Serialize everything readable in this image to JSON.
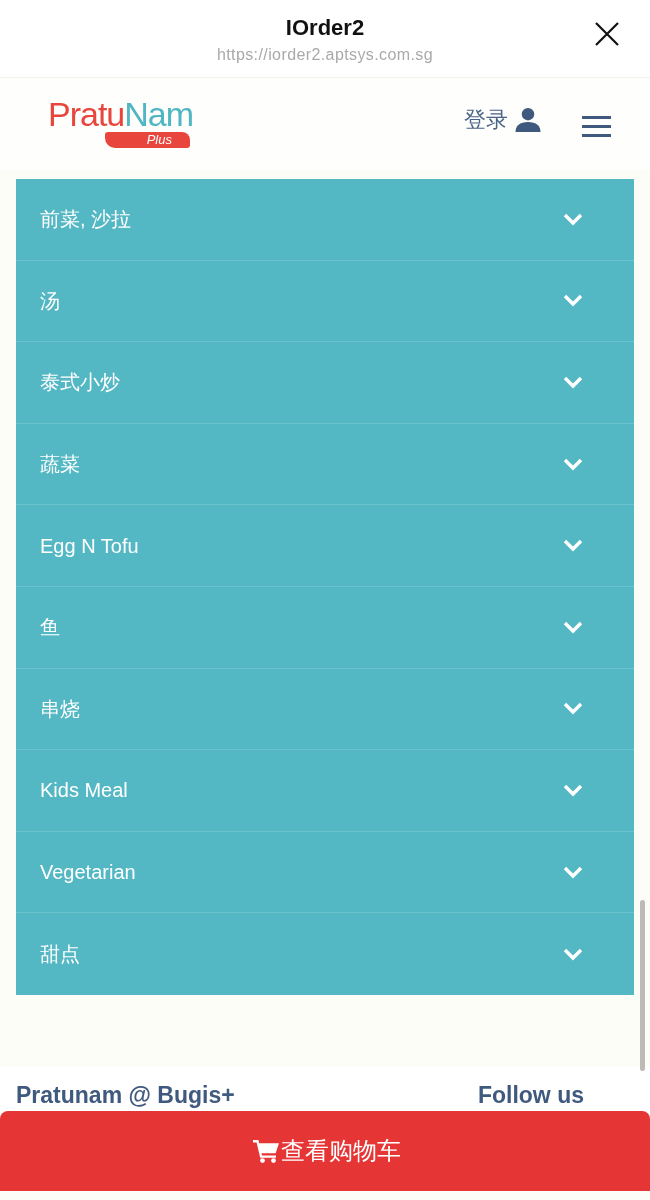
{
  "browser_bar": {
    "title": "IOrder2",
    "url": "https://iorder2.aptsys.com.sg"
  },
  "header": {
    "logo": {
      "word_1": "Pratu",
      "word_2": "Nam",
      "badge": "Plus"
    },
    "login_label": "登录"
  },
  "categories": [
    {
      "label": "前菜, 沙拉",
      "expanded": false
    },
    {
      "label": "汤",
      "expanded": false
    },
    {
      "label": "泰式小炒",
      "expanded": false
    },
    {
      "label": "蔬菜",
      "expanded": false
    },
    {
      "label": "Egg N Tofu",
      "expanded": false
    },
    {
      "label": "鱼",
      "expanded": false
    },
    {
      "label": "串烧",
      "expanded": false
    },
    {
      "label": "Kids Meal",
      "expanded": false
    },
    {
      "label": "Vegetarian",
      "expanded": false
    },
    {
      "label": "甜点",
      "expanded": false
    }
  ],
  "footer": {
    "store_heading": "Pratunam @ Bugis+",
    "follow_heading": "Follow us"
  },
  "cart_button": {
    "label": "查看购物车"
  }
}
